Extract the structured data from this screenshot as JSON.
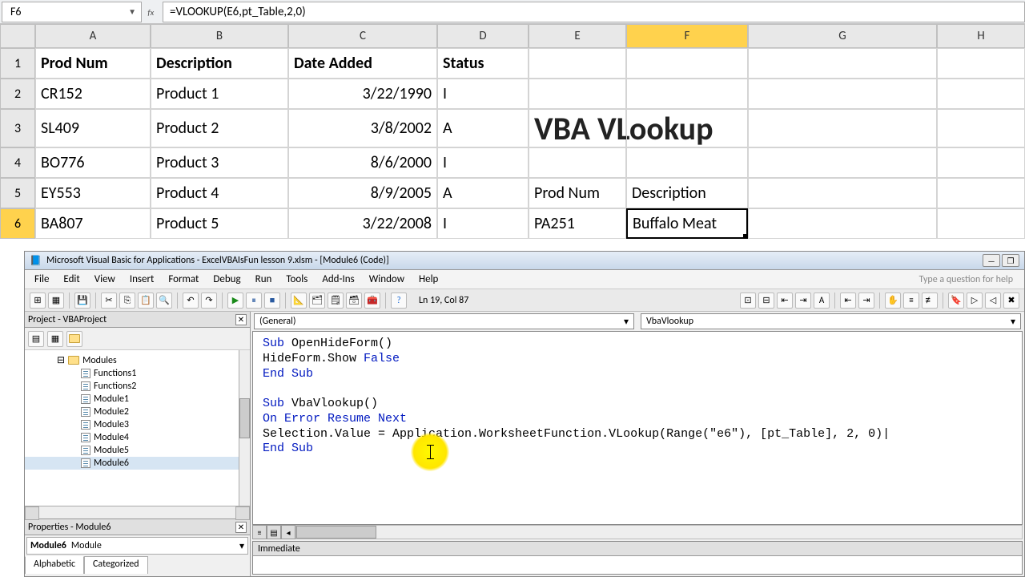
{
  "namebox": "F6",
  "formula": "=VLOOKUP(E6,pt_Table,2,0)",
  "columns": [
    "A",
    "B",
    "C",
    "D",
    "E",
    "F",
    "G",
    "H"
  ],
  "active_col_index": 5,
  "rows": {
    "headers": [
      "Prod Num",
      "Description",
      "Date Added",
      "Status"
    ],
    "data": [
      {
        "n": "1"
      },
      {
        "n": "2",
        "a": "CR152",
        "b": "Product 1",
        "c": "3/22/1990",
        "d": "I"
      },
      {
        "n": "3",
        "a": "SL409",
        "b": "Product 2",
        "c": "3/8/2002",
        "d": "A"
      },
      {
        "n": "4",
        "a": "BO776",
        "b": "Product 3",
        "c": "8/6/2000",
        "d": "I"
      },
      {
        "n": "5",
        "a": "EY553",
        "b": "Product 4",
        "c": "8/9/2005",
        "d": "A"
      },
      {
        "n": "6",
        "a": "BA807",
        "b": "Product 5",
        "c": "3/22/2008",
        "d": "I"
      }
    ],
    "overlay": {
      "title": "VBA VLookup",
      "e5": "Prod Num",
      "f5": "Description",
      "e6": "PA251",
      "f6": "Buffalo Meat"
    },
    "active_row": "6"
  },
  "vba": {
    "title": "Microsoft Visual Basic for Applications - ExcelVBAIsFun lesson 9.xlsm - [Module6 (Code)]",
    "menus": [
      "File",
      "Edit",
      "View",
      "Insert",
      "Format",
      "Debug",
      "Run",
      "Tools",
      "Add-Ins",
      "Window",
      "Help"
    ],
    "help_placeholder": "Type a question for help",
    "cursor": "Ln 19, Col 87",
    "project_title": "Project - VBAProject",
    "modules_label": "Modules",
    "modules": [
      "Functions1",
      "Functions2",
      "Module1",
      "Module2",
      "Module3",
      "Module4",
      "Module5",
      "Module6"
    ],
    "selected_module": "Module6",
    "props_title": "Properties - Module6",
    "prop_name": "Module6",
    "prop_type": "Module",
    "prop_tabs": [
      "Alphabetic",
      "Categorized"
    ],
    "code_select_left": "(General)",
    "code_select_right": "VbaVlookup",
    "code": {
      "l1a": "Sub",
      "l1b": " OpenHideForm()",
      "l2a": "HideForm.Show ",
      "l2b": "False",
      "l3": "End Sub",
      "l4a": "Sub",
      "l4b": " VbaVlookup()",
      "l5": "On Error Resume Next",
      "l6": "Selection.Value = Application.WorksheetFunction.VLookup(Range(\"e6\"), [pt_Table], 2, 0)|",
      "l7": "End Sub"
    },
    "immediate": "Immediate"
  }
}
